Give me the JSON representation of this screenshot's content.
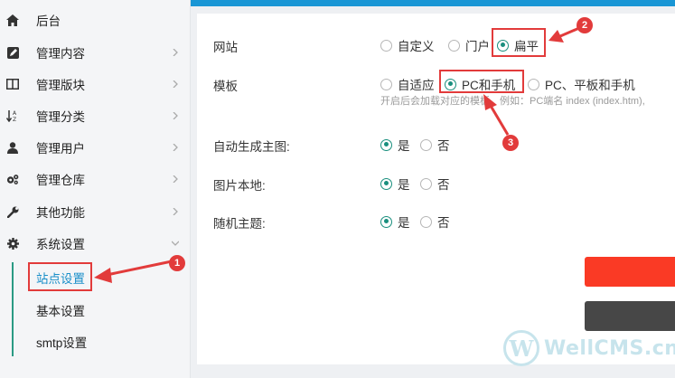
{
  "sidebar": {
    "items": [
      {
        "label": "后台",
        "icon": "home-icon"
      },
      {
        "label": "管理内容",
        "icon": "edit-icon"
      },
      {
        "label": "管理版块",
        "icon": "columns-icon"
      },
      {
        "label": "管理分类",
        "icon": "sort-icon"
      },
      {
        "label": "管理用户",
        "icon": "user-icon"
      },
      {
        "label": "管理仓库",
        "icon": "cogs-icon"
      },
      {
        "label": "其他功能",
        "icon": "wrench-icon"
      },
      {
        "label": "系统设置",
        "icon": "gear-icon"
      }
    ],
    "sub_items": [
      {
        "label": "站点设置",
        "active": true
      },
      {
        "label": "基本设置"
      },
      {
        "label": "smtp设置"
      }
    ]
  },
  "form": {
    "website": {
      "label": "网站",
      "options": [
        "自定义",
        "门户",
        "扁平"
      ],
      "selected": "扁平"
    },
    "template": {
      "label": "模板",
      "options": [
        "自适应",
        "PC和手机",
        "PC、平板和手机"
      ],
      "selected": "PC和手机",
      "hint": "开启后会加载对应的模板，例如：PC端名 index (index.htm),"
    },
    "auto_thumb": {
      "label": "自动生成主图:",
      "yes": "是",
      "no": "否",
      "selected": "是"
    },
    "local_images": {
      "label": "图片本地:",
      "yes": "是",
      "no": "否",
      "selected": "是"
    },
    "random_theme": {
      "label": "随机主题:",
      "yes": "是",
      "no": "否",
      "selected": "是"
    }
  },
  "annotations": [
    "1",
    "2",
    "3"
  ],
  "watermark": {
    "logo": "W",
    "text": "WellCMS.cn"
  },
  "colors": {
    "accent": "#1a8f7e",
    "annotation": "#e23b3b",
    "topbar": "#1996d5",
    "primary_button": "#fa3a25",
    "secondary_button": "#474747"
  }
}
